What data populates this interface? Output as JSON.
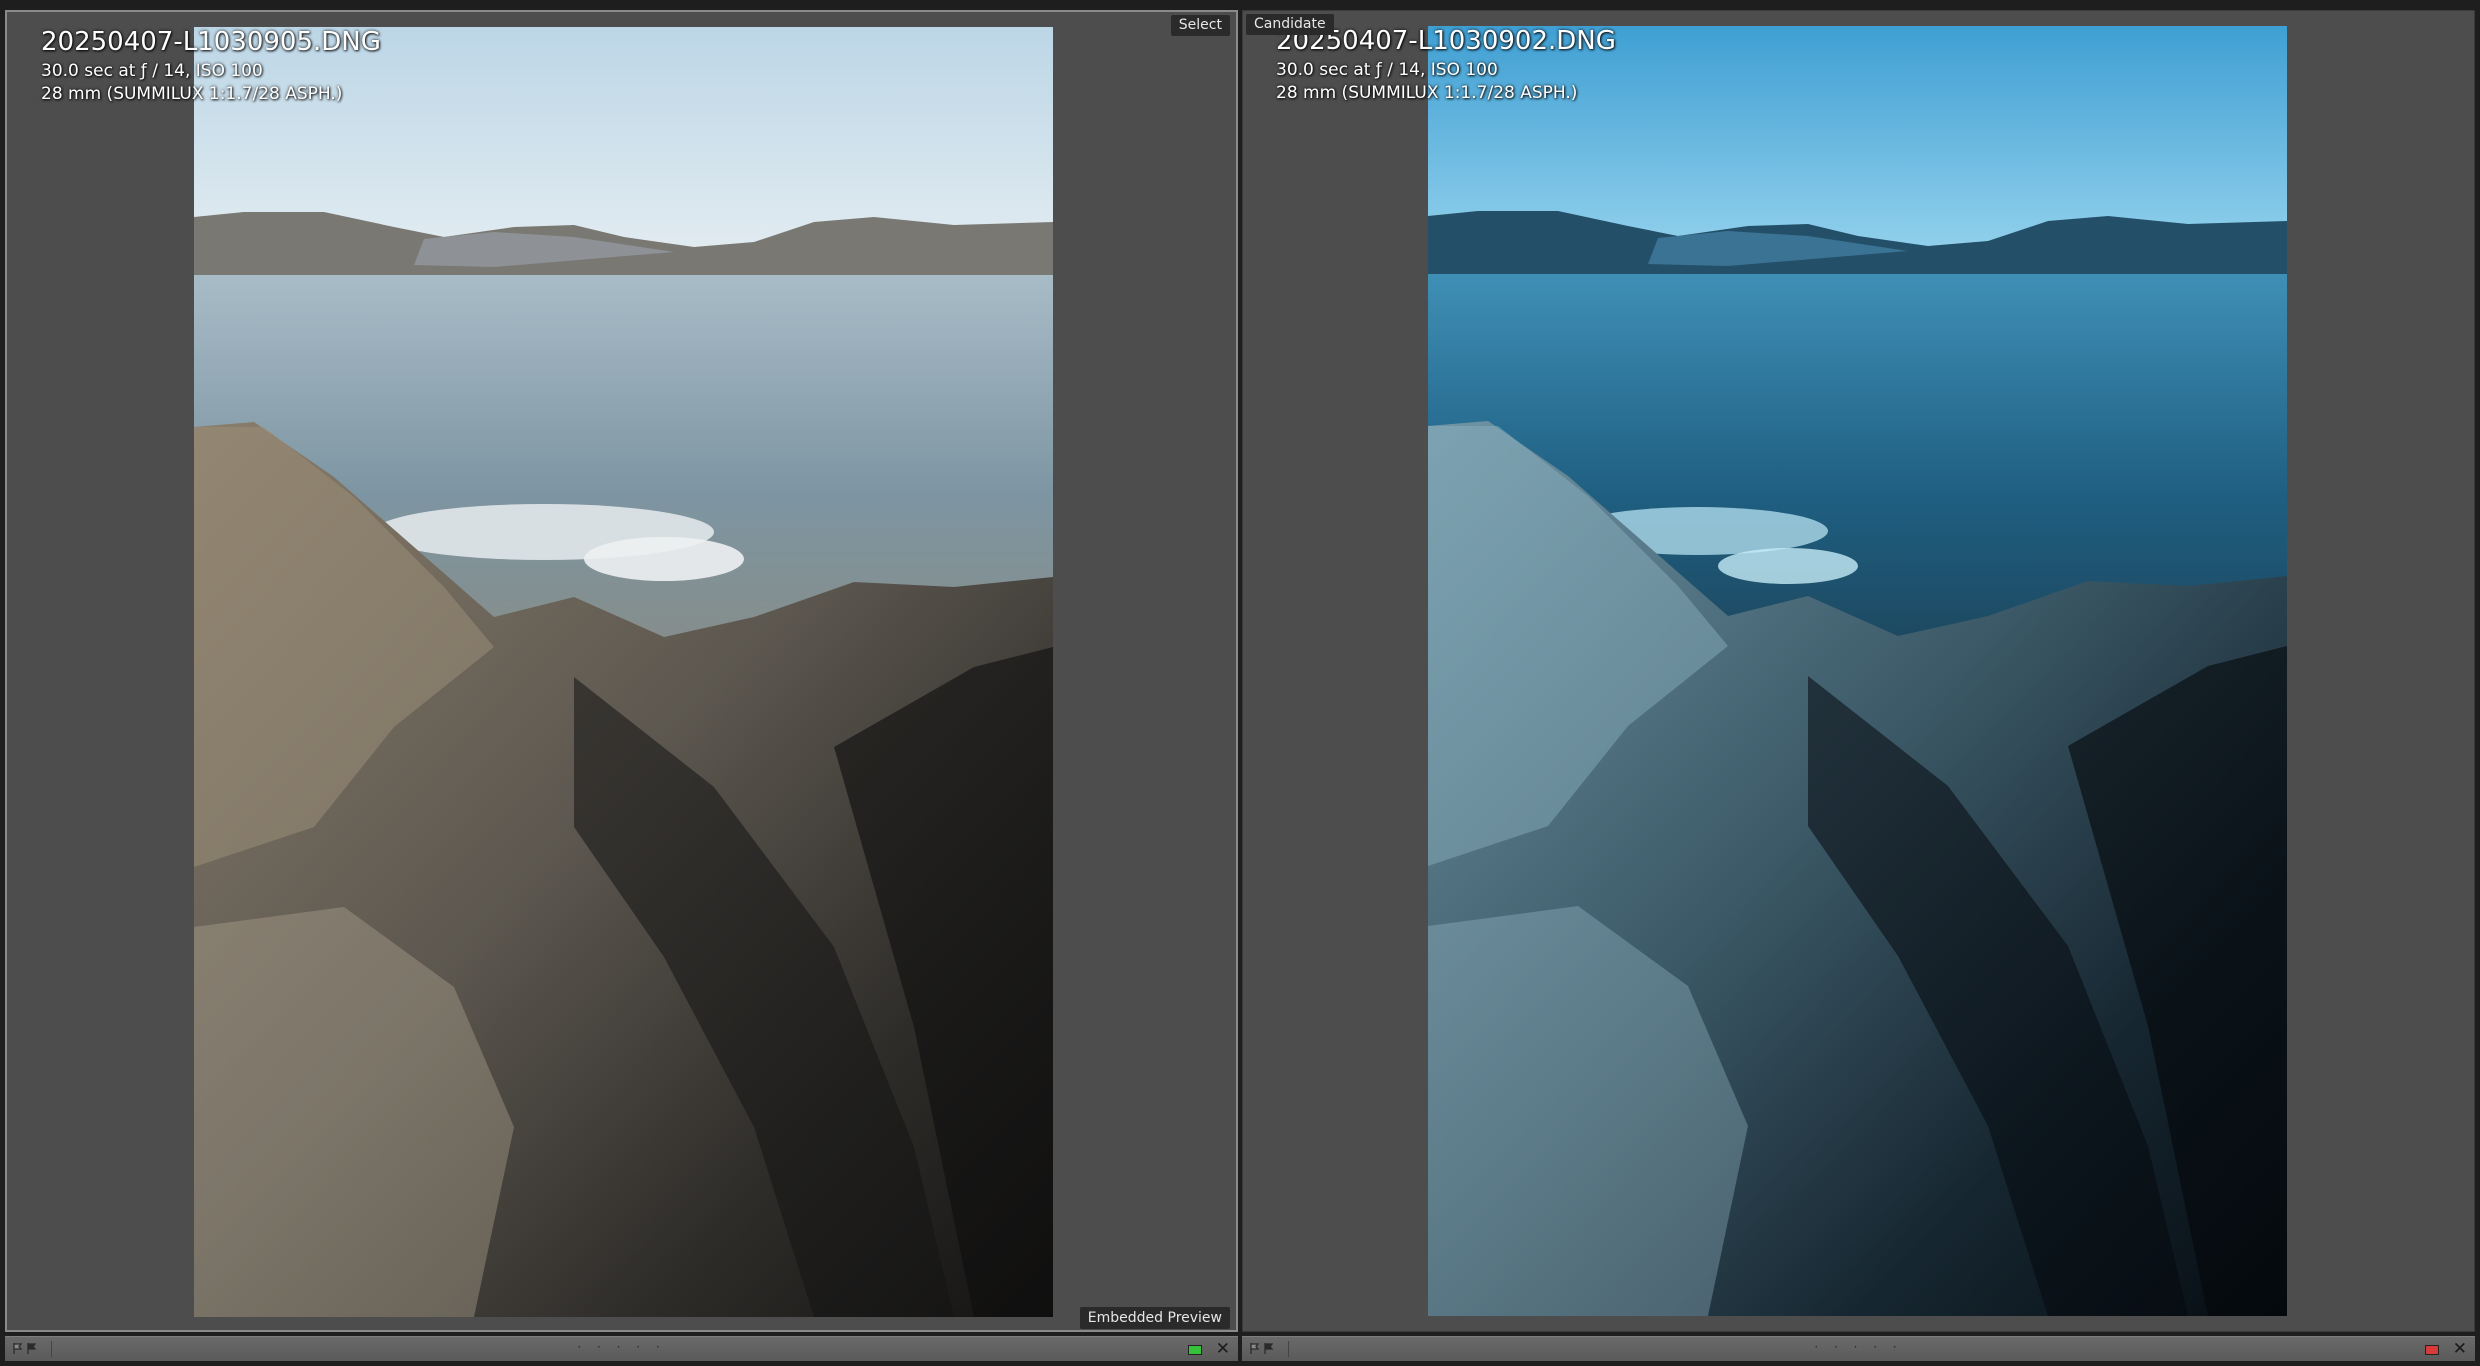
{
  "left": {
    "filename": "20250407-L1030905.DNG",
    "exposure": "30.0 sec at ƒ / 14, ISO 100",
    "lens": "28 mm (SUMMILUX 1:1.7/28 ASPH.)",
    "role_label": "Select",
    "preview_label": "Embedded Preview",
    "rating_dots": "· · · · ·",
    "color_label": "#35c23a",
    "close_glyph": "✕"
  },
  "right": {
    "filename": "20250407-L1030902.DNG",
    "exposure": "30.0 sec at ƒ / 14, ISO 100",
    "lens": "28 mm (SUMMILUX 1:1.7/28 ASPH.)",
    "role_label": "Candidate",
    "rating_dots": "· · · · ·",
    "color_label": "#d83a3a",
    "close_glyph": "✕"
  },
  "icons": {
    "flag_pick": "flag-icon",
    "flag_reject": "reject-flag-icon",
    "close": "close-icon"
  }
}
